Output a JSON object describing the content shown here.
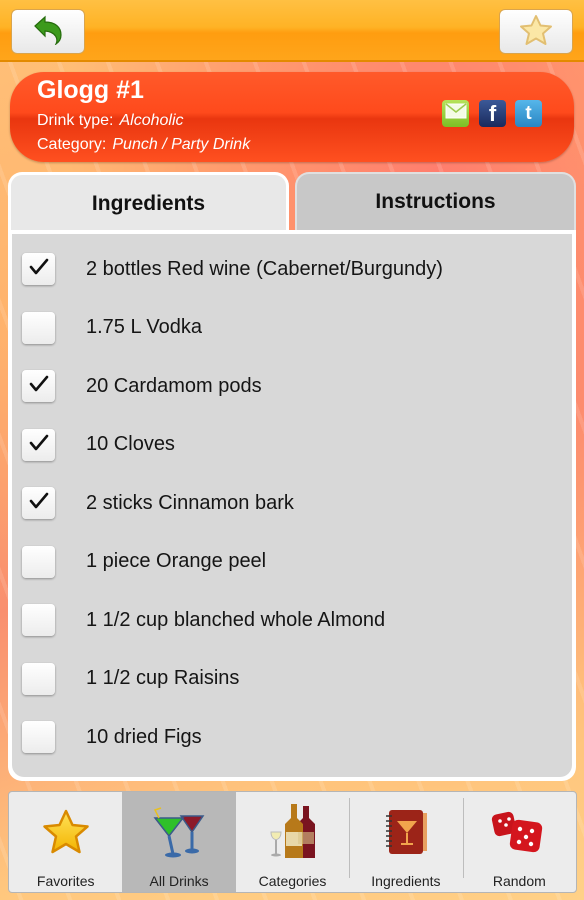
{
  "topbar": {
    "back_icon": "back-arrow-icon",
    "favorite_icon": "star-icon"
  },
  "drink": {
    "name": "Glogg #1",
    "type_label": "Drink type:",
    "type_value": "Alcoholic",
    "category_label": "Category:",
    "category_value": "Punch / Party Drink"
  },
  "share": {
    "email_icon": "email-icon",
    "facebook_icon": "facebook-icon",
    "facebook_glyph": "f",
    "twitter_icon": "twitter-icon",
    "twitter_glyph": "t"
  },
  "tabs": [
    {
      "label": "Ingredients",
      "active": true
    },
    {
      "label": "Instructions",
      "active": false
    }
  ],
  "ingredients": [
    {
      "label": "2 bottles Red wine (Cabernet/Burgundy)",
      "checked": true
    },
    {
      "label": "1.75 L Vodka",
      "checked": false
    },
    {
      "label": "20 Cardamom pods",
      "checked": true
    },
    {
      "label": "10 Cloves",
      "checked": true
    },
    {
      "label": "2 sticks Cinnamon bark",
      "checked": true
    },
    {
      "label": "1 piece Orange peel",
      "checked": false
    },
    {
      "label": "1 1/2 cup blanched whole Almond",
      "checked": false
    },
    {
      "label": "1 1/2 cup Raisins",
      "checked": false
    },
    {
      "label": "10 dried Figs",
      "checked": false
    },
    {
      "label": "",
      "checked": false
    }
  ],
  "bottom_nav": [
    {
      "label": "Favorites",
      "icon": "star-icon",
      "active": false
    },
    {
      "label": "All Drinks",
      "icon": "cocktail-glasses-icon",
      "active": true
    },
    {
      "label": "Categories",
      "icon": "bottles-icon",
      "active": false
    },
    {
      "label": "Ingredients",
      "icon": "recipe-book-icon",
      "active": false
    },
    {
      "label": "Random",
      "icon": "dice-icon",
      "active": false
    }
  ],
  "colors": {
    "topbar": "#ffb325",
    "header": "#ff4a1c",
    "tab_active": "#e8e8e8",
    "tab_inactive": "#c8c8c8",
    "list_bg": "#d8d8d8"
  }
}
